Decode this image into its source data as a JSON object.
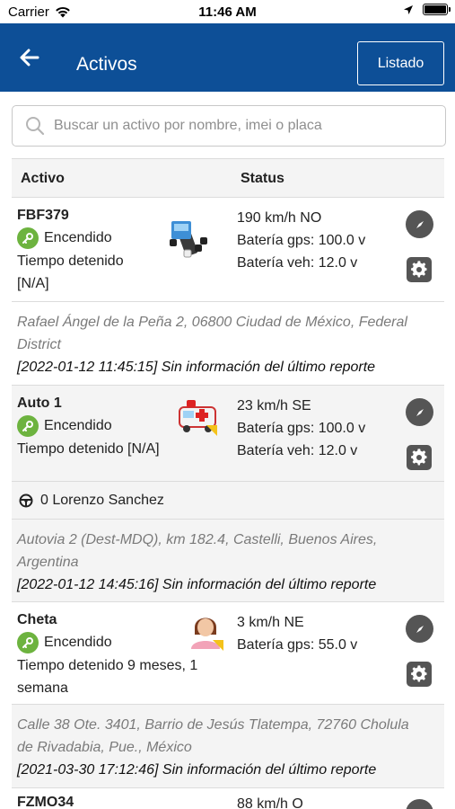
{
  "status_bar": {
    "carrier": "Carrier",
    "time": "11:46 AM"
  },
  "header": {
    "title": "Activos",
    "list_button": "Listado"
  },
  "search": {
    "placeholder": "Buscar un activo por nombre, imei o placa"
  },
  "table": {
    "col_asset": "Activo",
    "col_status": "Status"
  },
  "assets": [
    {
      "name": "FBF379",
      "state": "Encendido",
      "detail_1": "Tiempo detenido",
      "detail_2": "[N/A]",
      "speed": "190 km/h NO",
      "gps_battery": "Batería gps: 100.0 v",
      "vehicle_battery": "Batería veh: 12.0 v",
      "icon": "truck-icon",
      "address_1": "Rafael Ángel de la Peña 2, 06800 Ciudad de México, Federal",
      "address_2": "District",
      "report": "[2022-01-12 11:45:15] Sin información del último reporte"
    },
    {
      "name": "Auto 1",
      "state": "Encendido",
      "detail_1": "Tiempo detenido [N/A]",
      "speed": "23 km/h SE",
      "gps_battery": "Batería gps: 100.0 v",
      "vehicle_battery": "Batería veh: 12.0 v",
      "icon": "ambulance-icon",
      "driver": "0 Lorenzo Sanchez",
      "address_1": "Autovia 2 (Dest-MDQ), km 182.4, Castelli, Buenos Aires,",
      "address_2": "Argentina",
      "report": "[2022-01-12 14:45:16] Sin información del último reporte"
    },
    {
      "name": "Cheta",
      "state": "Encendido",
      "detail_1": "Tiempo detenido 9 meses, 1",
      "detail_2": "semana",
      "speed": "3 km/h NE",
      "gps_battery": "Batería gps: 55.0 v",
      "icon": "person-icon",
      "address_1": "Calle 38 Ote. 3401, Barrio de Jesús Tlatempa, 72760 Cholula",
      "address_2": "de Rivadabia, Pue., México",
      "report": "[2021-03-30 17:12:46] Sin información del último reporte"
    },
    {
      "name": "FZMO34",
      "speed": "88 km/h O"
    }
  ],
  "colors": {
    "header_bg": "#0d4f97",
    "key_green": "#6db33f",
    "button_gray": "#555555"
  }
}
